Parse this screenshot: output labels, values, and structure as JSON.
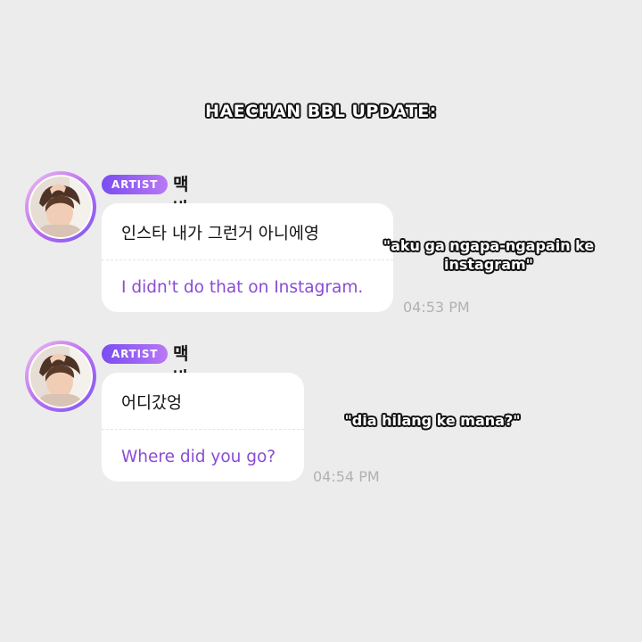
{
  "headline": "HAECHAN BBL UPDATE:",
  "messages": [
    {
      "badge": "ARTIST",
      "username": "맥반석",
      "original": "인스타 내가 그런거 아니에영",
      "translation": "I didn't do that on Instagram.",
      "time": "04:53 PM",
      "caption": "\"aku ga ngapa-ngapain ke instagram\""
    },
    {
      "badge": "ARTIST",
      "username": "맥반석",
      "original": "어디갔엉",
      "translation": "Where did you go?",
      "time": "04:54 PM",
      "caption": "\"dia hilang ke mana?\""
    }
  ],
  "colors": {
    "background": "#ececec",
    "translation_text": "#8a4bd6",
    "badge_gradient_start": "#7a4cf2",
    "badge_gradient_end": "#b978f5"
  },
  "icons": {
    "avatar": "artist-avatar-photo"
  }
}
